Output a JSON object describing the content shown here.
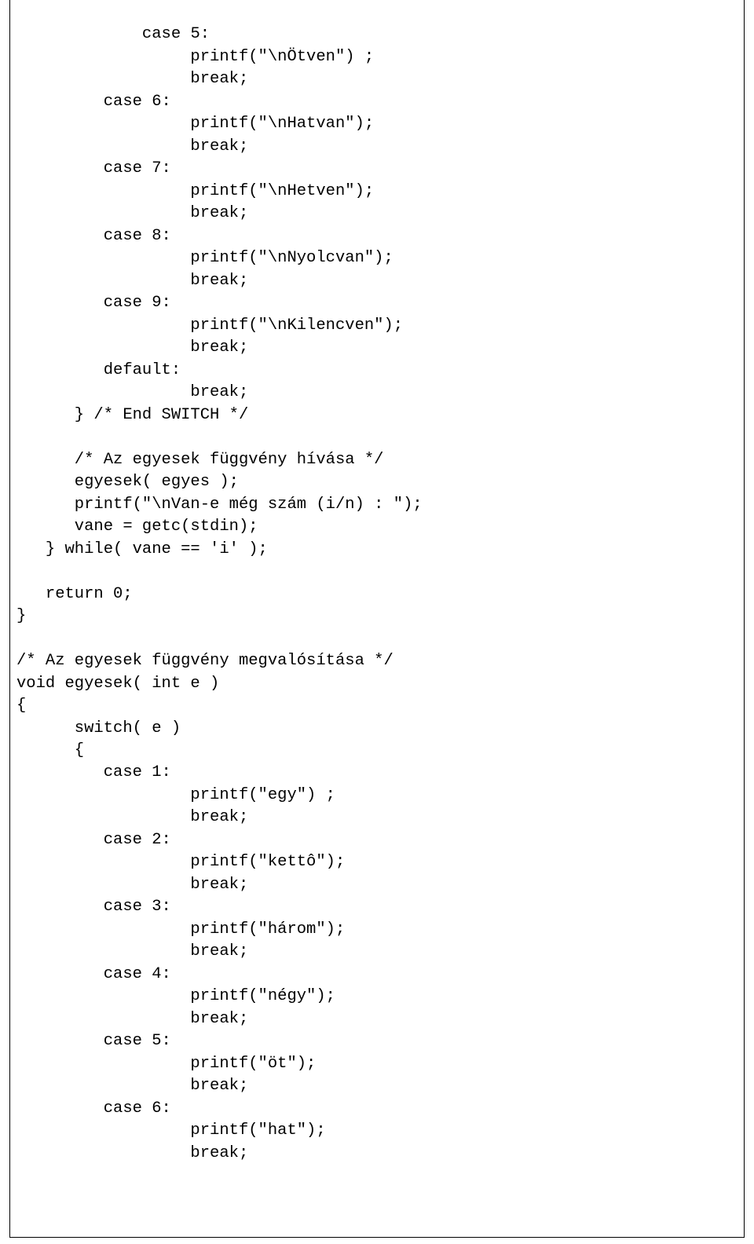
{
  "code": {
    "lines": [
      "         case 5:",
      "                  printf(\"\\nÖtven\") ;",
      "                  break;",
      "         case 6:",
      "                  printf(\"\\nHatvan\");",
      "                  break;",
      "         case 7:",
      "                  printf(\"\\nHetven\");",
      "                  break;",
      "         case 8:",
      "                  printf(\"\\nNyolcvan\");",
      "                  break;",
      "         case 9:",
      "                  printf(\"\\nKilencven\");",
      "                  break;",
      "         default:",
      "                  break;",
      "      } /* End SWITCH */",
      "",
      "      /* Az egyesek függvény hívása */",
      "      egyesek( egyes );",
      "      printf(\"\\nVan-e még szám (i/n) : \");",
      "      vane = getc(stdin);",
      "   } while( vane == 'i' );",
      "",
      "   return 0;",
      "}",
      "",
      "/* Az egyesek függvény megvalósítása */",
      "void egyesek( int e )",
      "{",
      "      switch( e )",
      "      {",
      "         case 1:",
      "                  printf(\"egy\") ;",
      "                  break;",
      "         case 2:",
      "                  printf(\"kettô\");",
      "                  break;",
      "         case 3:",
      "                  printf(\"három\");",
      "                  break;",
      "         case 4:",
      "                  printf(\"négy\");",
      "                  break;",
      "         case 5:",
      "                  printf(\"öt\");",
      "                  break;",
      "         case 6:",
      "                  printf(\"hat\");",
      "                  break;"
    ]
  }
}
